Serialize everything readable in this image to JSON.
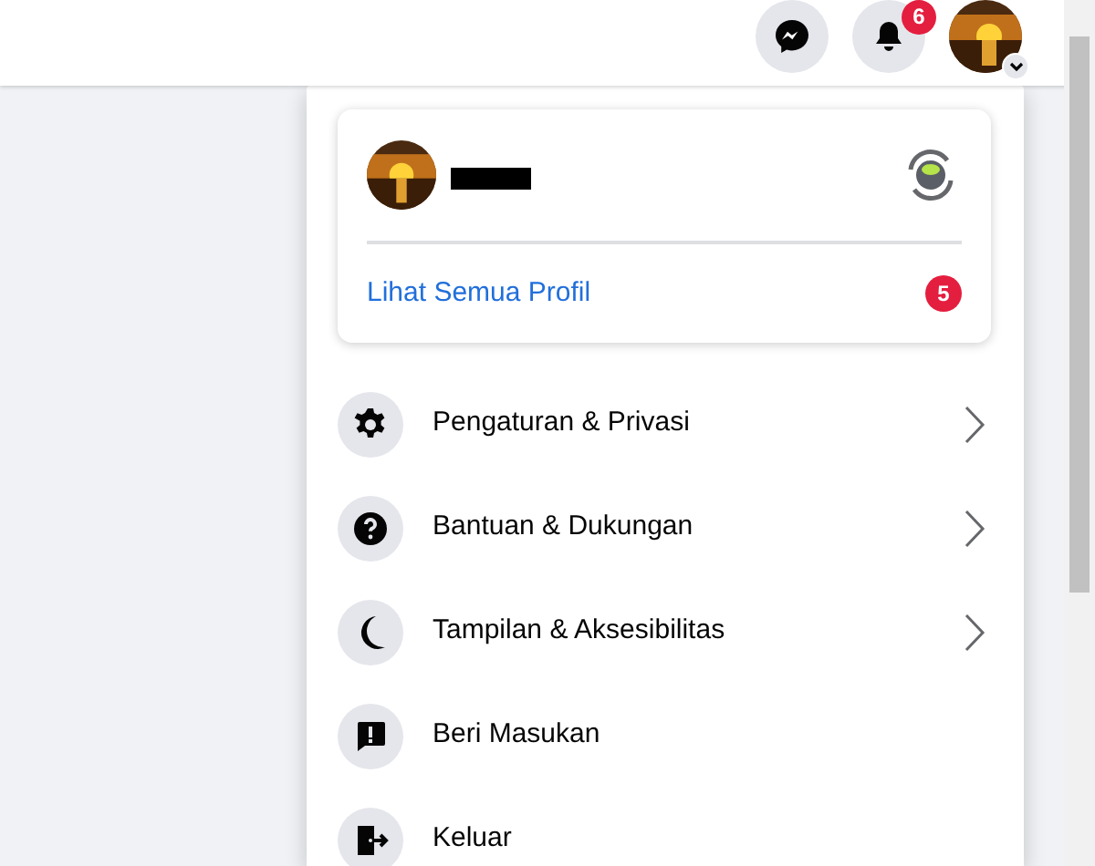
{
  "top_bar": {
    "notification_count": "6"
  },
  "profile_card": {
    "link": "Lihat Semua Profil",
    "badge": "5"
  },
  "menu": [
    {
      "label": "Pengaturan & Privasi",
      "submenu": true
    },
    {
      "label": "Bantuan & Dukungan",
      "submenu": true
    },
    {
      "label": "Tampilan & Aksesibilitas",
      "submenu": true
    },
    {
      "label": "Beri Masukan",
      "submenu": false
    },
    {
      "label": "Keluar",
      "submenu": false
    }
  ]
}
